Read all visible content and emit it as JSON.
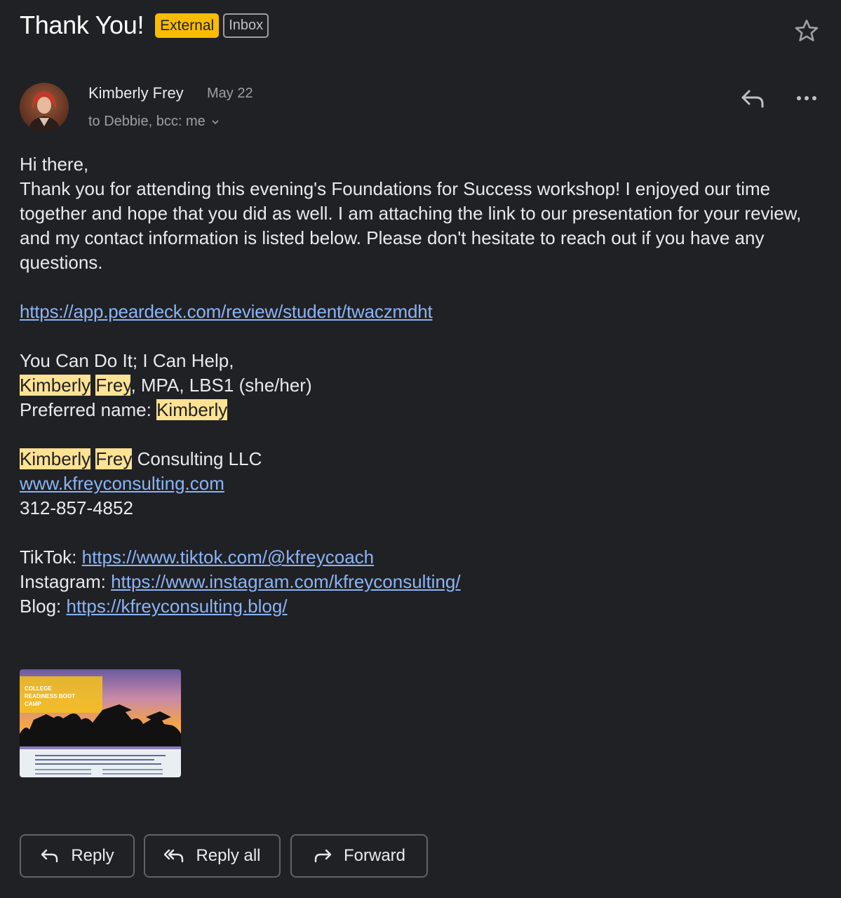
{
  "email": {
    "subject": "Thank You!",
    "labels": {
      "external": "External",
      "inbox": "Inbox"
    },
    "sender": {
      "name": "Kimberly Frey",
      "date": "May 22",
      "recipients": "to Debbie, bcc: me"
    },
    "body": {
      "greeting": "Hi there,",
      "paragraph": "Thank you for attending this evening's Foundations for Success workshop! I enjoyed our time together and hope that you did as well. I am attaching the link to our presentation for your review, and my contact information is listed below. Please don't hesitate to reach out if you have any questions.",
      "presentation_link": "https://app.peardeck.com/review/student/twaczmdht",
      "signoff": "You Can Do It; I Can Help,",
      "signature": {
        "first_name": "Kimberly",
        "last_name": "Frey",
        "credentials": ", MPA, LBS1 (she/her)",
        "preferred_label": "Preferred name: ",
        "preferred_name": "Kimberly",
        "company_suffix": " Consulting LLC",
        "website": "www.kfreyconsulting.com",
        "phone": "312-857-4852",
        "tiktok_label": "TikTok: ",
        "tiktok_url": "https://www.tiktok.com/@kfreycoach",
        "instagram_label": "Instagram: ",
        "instagram_url": "https://www.instagram.com/kfreyconsulting/",
        "blog_label": "Blog: ",
        "blog_url": "https://kfreyconsulting.blog/"
      }
    },
    "attachment": {
      "title": "COLLEGE READINESS BOOT CAMP"
    }
  },
  "actions": {
    "reply": "Reply",
    "reply_all": "Reply all",
    "forward": "Forward"
  },
  "colors": {
    "background": "#202124",
    "link": "#8ab4f8",
    "highlight": "#fde293",
    "external_badge": "#fbbc04"
  }
}
